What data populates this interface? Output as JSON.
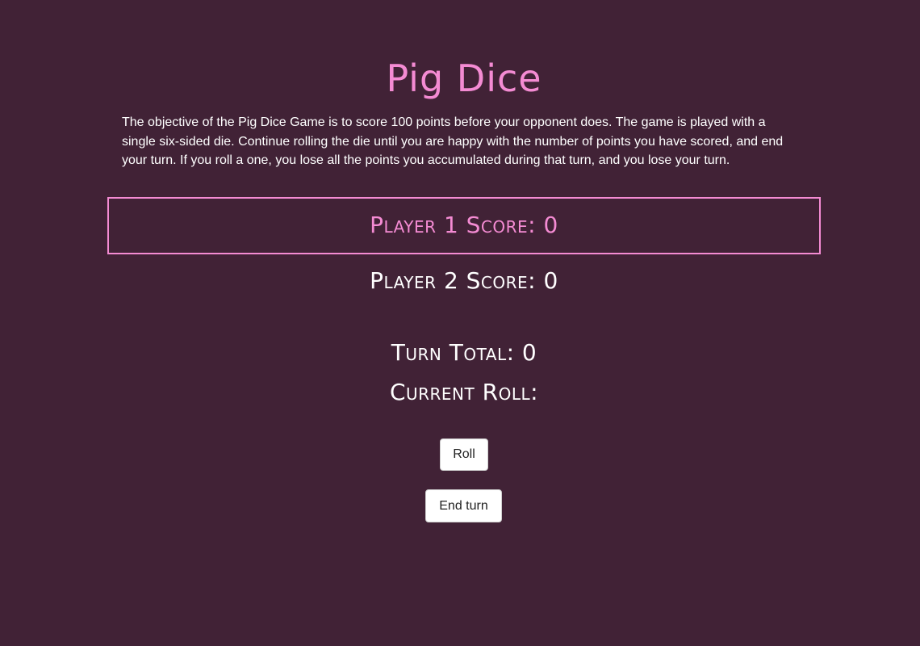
{
  "header": {
    "title": "Pig Dice"
  },
  "intro": {
    "text": "The objective of the Pig Dice Game is to score 100 points before your opponent does. The game is played with a single six-sided die. Continue rolling the die until you are happy with the number of points you have scored, and end your turn. If you roll a one, you lose all the points you accumulated during that turn, and you lose your turn."
  },
  "scores": {
    "player1": "Player 1 Score: 0",
    "player2": "Player 2 Score: 0"
  },
  "turn": {
    "total": "Turn Total: 0",
    "current_roll": "Current Roll:"
  },
  "controls": {
    "roll_label": "Roll",
    "end_turn_label": "End turn"
  },
  "colors": {
    "background": "#412236",
    "accent": "#f48bd3",
    "text": "#ffffff"
  }
}
